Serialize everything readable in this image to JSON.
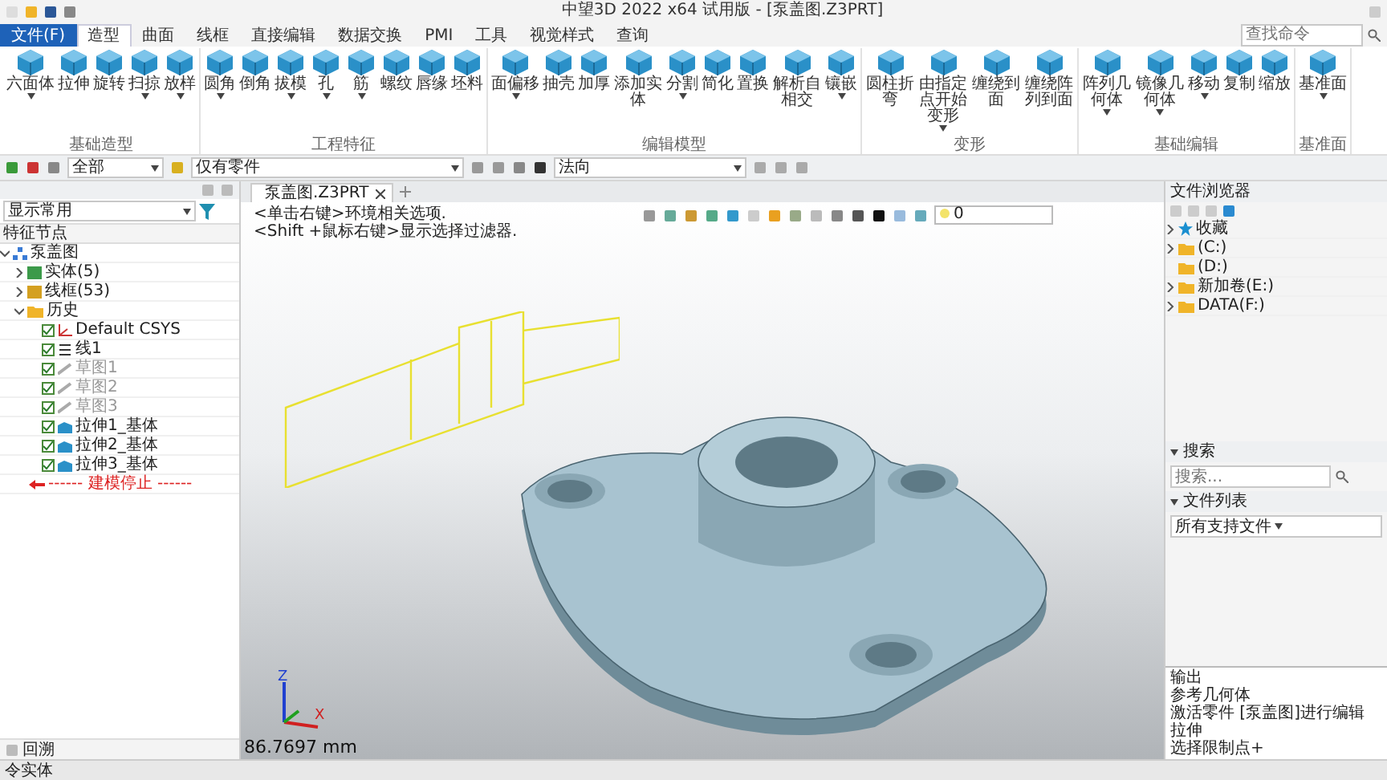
{
  "title_bar": {
    "title": "中望3D 2022 x64 试用版 - [泵盖图.Z3PRT]"
  },
  "menu_tabs": [
    {
      "label": "文件(F)",
      "kind": "file",
      "selected": false
    },
    {
      "label": "造型",
      "kind": "tab",
      "selected": true
    },
    {
      "label": "曲面",
      "kind": "tab",
      "selected": false
    },
    {
      "label": "线框",
      "kind": "tab",
      "selected": false
    },
    {
      "label": "直接编辑",
      "kind": "tab",
      "selected": false
    },
    {
      "label": "数据交换",
      "kind": "tab",
      "selected": false
    },
    {
      "label": "PMI",
      "kind": "tab",
      "selected": false
    },
    {
      "label": "工具",
      "kind": "tab",
      "selected": false
    },
    {
      "label": "视觉样式",
      "kind": "tab",
      "selected": false
    },
    {
      "label": "查询",
      "kind": "tab",
      "selected": false
    }
  ],
  "command_search": {
    "placeholder": "查找命令"
  },
  "ribbon_groups": [
    {
      "title": "基础造型",
      "buttons": [
        {
          "label": "六面体",
          "dropdown": true
        },
        {
          "label": "拉伸",
          "dropdown": false
        },
        {
          "label": "旋转",
          "dropdown": false
        },
        {
          "label": "扫掠",
          "dropdown": true
        },
        {
          "label": "放样",
          "dropdown": true
        }
      ]
    },
    {
      "title": "工程特征",
      "buttons": [
        {
          "label": "圆角",
          "dropdown": true
        },
        {
          "label": "倒角",
          "dropdown": false
        },
        {
          "label": "拔模",
          "dropdown": true
        },
        {
          "label": "孔",
          "dropdown": true
        },
        {
          "label": "筋",
          "dropdown": true
        },
        {
          "label": "螺纹",
          "dropdown": false
        },
        {
          "label": "唇缘",
          "dropdown": false
        },
        {
          "label": "坯料",
          "dropdown": false
        }
      ]
    },
    {
      "title": "编辑模型",
      "buttons": [
        {
          "label": "面偏移",
          "dropdown": true
        },
        {
          "label": "抽壳",
          "dropdown": false
        },
        {
          "label": "加厚",
          "dropdown": false
        },
        {
          "label": "添加实体",
          "dropdown": false
        },
        {
          "label": "分割",
          "dropdown": true
        },
        {
          "label": "简化",
          "dropdown": false
        },
        {
          "label": "置换",
          "dropdown": false
        },
        {
          "label": "解析自相交",
          "dropdown": false
        },
        {
          "label": "镶嵌",
          "dropdown": true
        }
      ]
    },
    {
      "title": "变形",
      "buttons": [
        {
          "label": "圆柱折弯",
          "dropdown": false
        },
        {
          "label": "由指定点开始变形",
          "dropdown": true
        },
        {
          "label": "缠绕到面",
          "dropdown": false
        },
        {
          "label": "缠绕阵列到面",
          "dropdown": false
        }
      ]
    },
    {
      "title": "基础编辑",
      "buttons": [
        {
          "label": "阵列几何体",
          "dropdown": true
        },
        {
          "label": "镜像几何体",
          "dropdown": true
        },
        {
          "label": "移动",
          "dropdown": true
        },
        {
          "label": "复制",
          "dropdown": false
        },
        {
          "label": "缩放",
          "dropdown": false
        }
      ]
    },
    {
      "title": "基准面",
      "buttons": [
        {
          "label": "基准面",
          "dropdown": true
        }
      ]
    }
  ],
  "filter_bar": {
    "scope": "全部",
    "part_filter": "仅有零件",
    "direction": "法向"
  },
  "history_panel": {
    "display_mode": "显示常用",
    "column": "特征节点",
    "tree": [
      {
        "label": "泵盖图",
        "kind": "part",
        "expanded": true,
        "children": [
          {
            "label": "实体(5)",
            "kind": "solid",
            "expanded": false
          },
          {
            "label": "线框(53)",
            "kind": "wire",
            "expanded": false
          },
          {
            "label": "历史",
            "kind": "folder",
            "expanded": true,
            "children": [
              {
                "label": "Default CSYS",
                "kind": "csys",
                "checked": true,
                "dimmed": false
              },
              {
                "label": "线1",
                "kind": "line",
                "checked": true,
                "dimmed": false
              },
              {
                "label": "草图1",
                "kind": "sketch",
                "checked": true,
                "dimmed": true
              },
              {
                "label": "草图2",
                "kind": "sketch",
                "checked": true,
                "dimmed": true
              },
              {
                "label": "草图3",
                "kind": "sketch",
                "checked": true,
                "dimmed": true
              },
              {
                "label": "拉伸1_基体",
                "kind": "extrude",
                "checked": true,
                "dimmed": false
              },
              {
                "label": "拉伸2_基体",
                "kind": "extrude",
                "checked": true,
                "dimmed": false
              },
              {
                "label": "拉伸3_基体",
                "kind": "extrude",
                "checked": true,
                "dimmed": false
              },
              {
                "label": "------ 建模停止 ------",
                "kind": "stop"
              }
            ]
          }
        ]
      }
    ],
    "rollback": "回溯"
  },
  "viewport": {
    "tab": "泵盖图.Z3PRT",
    "hints": [
      "<单击右键>环境相关选项.",
      "<Shift +鼠标右键>显示选择过滤器."
    ],
    "layer": "0",
    "axes": [
      "Z",
      "X"
    ],
    "measure": "86.7697 mm"
  },
  "file_browser": {
    "title": "文件浏览器",
    "tree": [
      {
        "label": "收藏",
        "kind": "favorite",
        "expandable": true
      },
      {
        "label": "(C:)",
        "kind": "drive",
        "expandable": true
      },
      {
        "label": "(D:)",
        "kind": "drive",
        "expandable": false
      },
      {
        "label": "新加卷(E:)",
        "kind": "drive",
        "expandable": true
      },
      {
        "label": "DATA(F:)",
        "kind": "drive",
        "expandable": true
      }
    ]
  },
  "search_section": {
    "title": "搜索",
    "placeholder": "搜索..."
  },
  "file_list": {
    "title": "文件列表",
    "filter": "所有支持文件"
  },
  "output": {
    "title": "输出",
    "lines": [
      "参考几何体",
      "激活零件 [泵盖图]进行编辑",
      "拉伸",
      "选择限制点+"
    ]
  },
  "status_bar": {
    "text": "令实体"
  }
}
